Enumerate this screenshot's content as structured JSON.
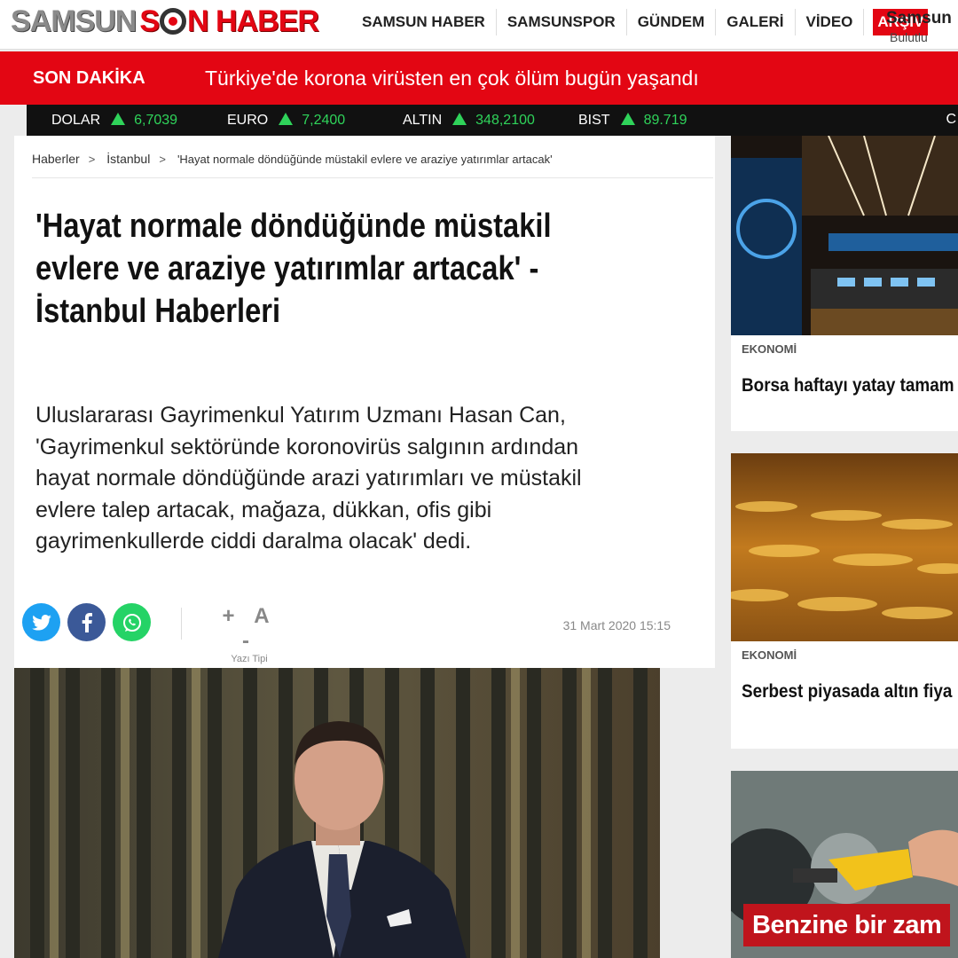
{
  "site": {
    "logo_part1": "SAMSUN",
    "logo_part2": "S",
    "logo_part3": "N HABER"
  },
  "nav": {
    "items": [
      "SAMSUN HABER",
      "SAMSUNSPOR",
      "GÜNDEM",
      "GALERİ",
      "VİDEO"
    ],
    "archive": "ARŞİV"
  },
  "weather": {
    "city": "Samsun",
    "condition": "Bulutlu"
  },
  "breaking": {
    "label": "SON DAKİKA",
    "headline": "Türkiye'de korona virüsten en çok ölüm bugün yaşandı"
  },
  "ticker": [
    {
      "name": "DOLAR",
      "value": "6,7039"
    },
    {
      "name": "EURO",
      "value": "7,2400"
    },
    {
      "name": "ALTIN",
      "value": "348,2100"
    },
    {
      "name": "BIST",
      "value": "89.719"
    }
  ],
  "ticker_trailing": "C",
  "article": {
    "breadcrumb": [
      "Haberler",
      "İstanbul",
      "'Hayat normale döndüğünde müstakil evlere ve araziye yatırımlar artacak'"
    ],
    "breadcrumb_sep": ">",
    "title_lines": [
      "'Hayat normale döndüğünde müstakil",
      "evlere ve araziye yatırımlar artacak' -",
      "İstanbul Haberleri"
    ],
    "summary_lines": [
      "Uluslararası Gayrimenkul Yatırım Uzmanı Hasan Can,",
      "'Gayrimenkul sektöründe koronovirüs salgının ardından",
      "hayat normale döndüğünde arazi yatırımları ve müstakil",
      "evlere talep artacak, mağaza, dükkan, ofis gibi",
      "gayrimenkullerde ciddi daralma olacak' dedi."
    ],
    "font_control": "+ A -",
    "font_label": "Yazı Tipi",
    "date": "31 Mart 2020 15:15"
  },
  "sidebar": [
    {
      "category": "EKONOMİ",
      "title": "Borsa haftayı yatay tamam"
    },
    {
      "category": "EKONOMİ",
      "title": "Serbest piyasada altın fiya"
    },
    {
      "overlay": "Benzine bir zam"
    }
  ],
  "colors": {
    "brand_red": "#e30613",
    "ticker_up": "#2fd35a",
    "twitter": "#1da1f2",
    "facebook": "#3b5998",
    "whatsapp": "#25d366"
  }
}
